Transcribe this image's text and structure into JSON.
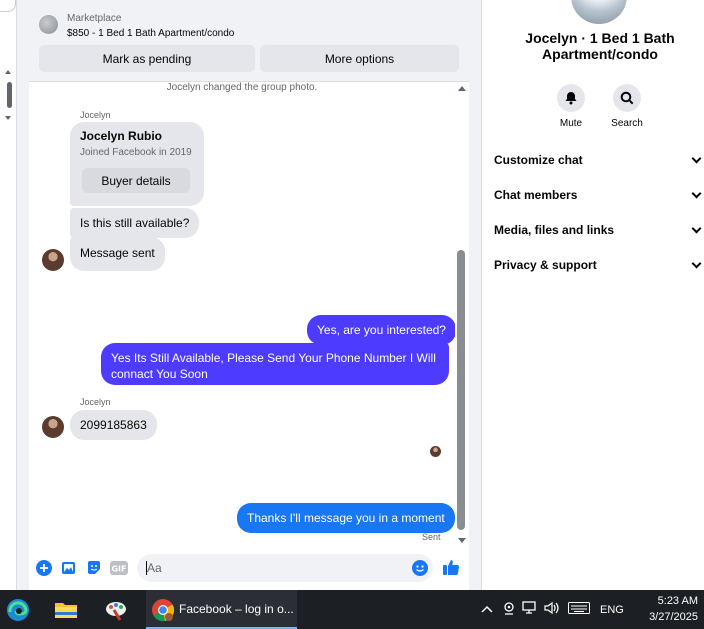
{
  "marketplace": {
    "label": "Marketplace",
    "listing": "$850 - 1 Bed 1 Bath Apartment/condo",
    "mark_pending": "Mark as pending",
    "more_options": "More options"
  },
  "messages": {
    "system": "Jocelyn changed the group photo.",
    "sender1": "Jocelyn",
    "card": {
      "name": "Jocelyn Rubio",
      "joined": "Joined Facebook in 2019",
      "button": "Buyer details"
    },
    "in1": "Is this still available?",
    "in2": "Message sent",
    "out1": "Yes, are you interested?",
    "out2_line1": "Yes Its Still Available, Please Send Your Phone Number I Will",
    "out2_line2": "connact You Soon",
    "sender2": "Jocelyn",
    "in3": "2099185863",
    "out3": "Thanks I'll message you in a moment",
    "sent": "Sent"
  },
  "composer": {
    "placeholder": "Aa"
  },
  "right_panel": {
    "name": "Jocelyn · 1 Bed 1 Bath Apartment/condo",
    "mute": "Mute",
    "search": "Search",
    "items": [
      "Customize chat",
      "Chat members",
      "Media, files and links",
      "Privacy & support"
    ]
  },
  "taskbar": {
    "app_label": "Facebook – log in o...",
    "lang": "ENG",
    "time": "5:23 AM",
    "date": "3/27/2025"
  },
  "colors": {
    "outgoing_bubble": "#4d3bff",
    "last_outgoing_bubble": "#1877f2",
    "incoming_bubble": "#e4e6eb",
    "accent": "#1877f2"
  }
}
